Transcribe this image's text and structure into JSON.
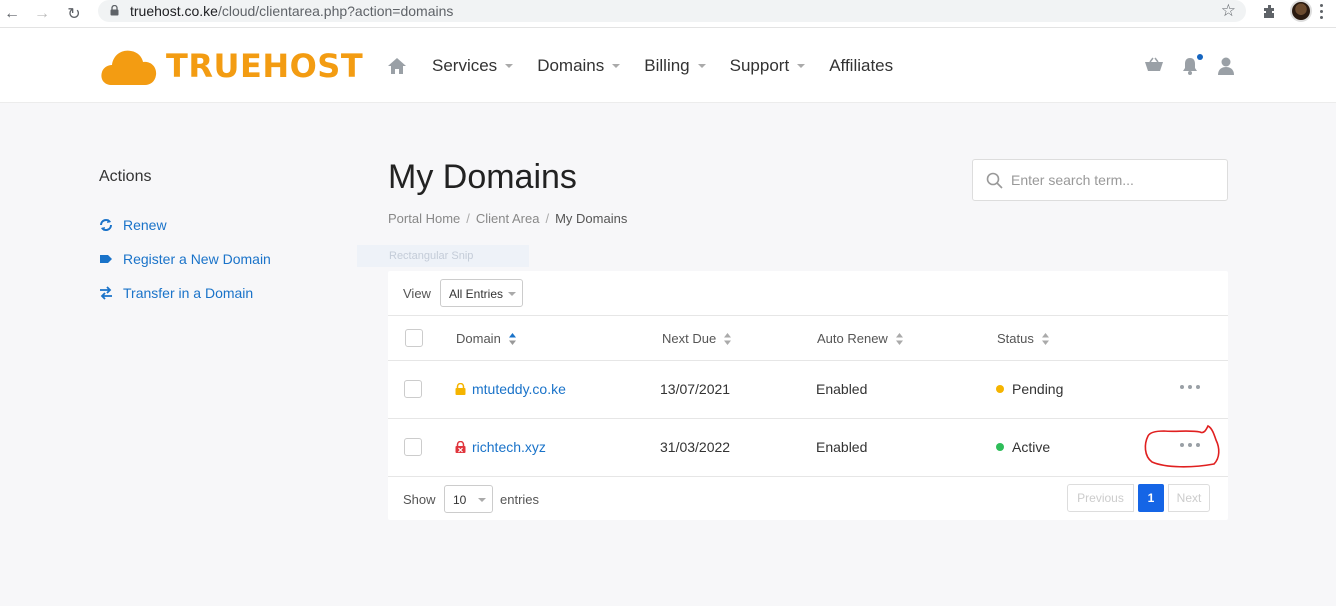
{
  "browser": {
    "url_host": "truehost.co.ke",
    "url_path": "/cloud/clientarea.php?action=domains"
  },
  "header": {
    "logo_text": "TRUEHOST",
    "nav": [
      {
        "label": "Services",
        "has_dropdown": true
      },
      {
        "label": "Domains",
        "has_dropdown": true
      },
      {
        "label": "Billing",
        "has_dropdown": true
      },
      {
        "label": "Support",
        "has_dropdown": true
      },
      {
        "label": "Affiliates",
        "has_dropdown": false
      }
    ],
    "icons": [
      "cart-icon",
      "bell-icon",
      "user-icon"
    ]
  },
  "sidebar": {
    "title": "Actions",
    "items": [
      {
        "label": "Renew",
        "icon": "renew-icon"
      },
      {
        "label": "Register a New Domain",
        "icon": "tag-icon"
      },
      {
        "label": "Transfer in a Domain",
        "icon": "transfer-icon"
      }
    ]
  },
  "page": {
    "title": "My Domains",
    "breadcrumb": [
      "Portal Home",
      "Client Area",
      "My Domains"
    ],
    "search_placeholder": "Enter search term...",
    "ghost_label": "Rectangular Snip"
  },
  "table": {
    "view_label": "View",
    "view_value": "All Entries",
    "columns": [
      "Domain",
      "Next Due",
      "Auto Renew",
      "Status"
    ],
    "rows": [
      {
        "domain": "mtuteddy.co.ke",
        "next_due": "13/07/2021",
        "auto_renew": "Enabled",
        "status": "Pending",
        "status_color": "#f5b400",
        "lock_color": "#f5b400"
      },
      {
        "domain": "richtech.xyz",
        "next_due": "31/03/2022",
        "auto_renew": "Enabled",
        "status": "Active",
        "status_color": "#2ebd59",
        "lock_color": "#e0343c"
      }
    ],
    "show_label": "Show",
    "page_length": "10",
    "entries_label": "entries",
    "pagination": {
      "previous": "Previous",
      "current": "1",
      "next": "Next"
    }
  },
  "colors": {
    "accent": "#1a73c9",
    "brand": "#f39c12",
    "annotation": "#e02020"
  }
}
